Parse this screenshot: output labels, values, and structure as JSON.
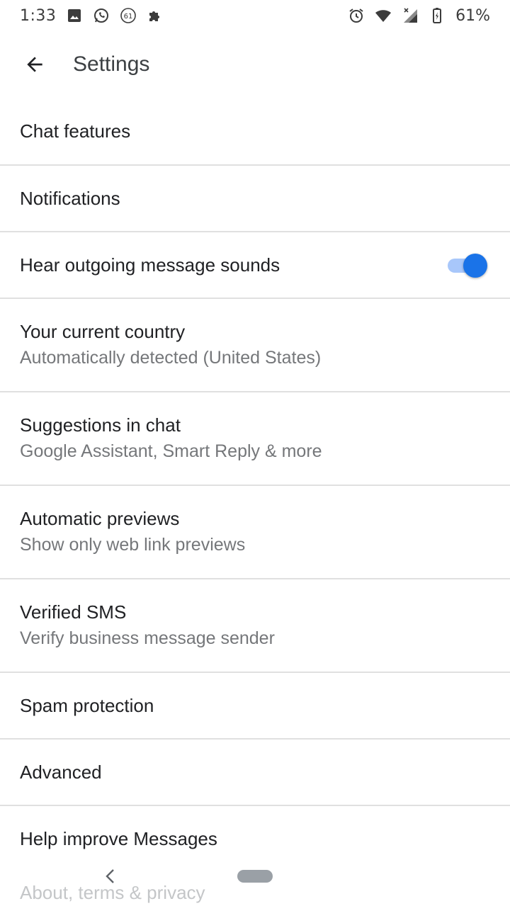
{
  "status_bar": {
    "time": "1:33",
    "notification_icons": [
      "image-icon",
      "whatsapp-icon",
      "badge-61-icon",
      "puzzle-icon"
    ],
    "badge_count": "61",
    "system_icons": [
      "alarm-icon",
      "wifi-icon",
      "signal-icon",
      "battery-icon"
    ],
    "battery_percent": "61%"
  },
  "app_bar": {
    "back_icon": "arrow-back-icon",
    "title": "Settings"
  },
  "settings": {
    "items": [
      {
        "title": "Chat features"
      },
      {
        "title": "Notifications"
      },
      {
        "title": "Hear outgoing message sounds",
        "toggle_on": true
      },
      {
        "title": "Your current country",
        "subtitle": "Automatically detected (United States)"
      },
      {
        "title": "Suggestions in chat",
        "subtitle": "Google Assistant, Smart Reply & more"
      },
      {
        "title": "Automatic previews",
        "subtitle": "Show only web link previews"
      },
      {
        "title": "Verified SMS",
        "subtitle": "Verify business message sender"
      },
      {
        "title": "Spam protection"
      },
      {
        "title": "Advanced"
      },
      {
        "title": "Help improve Messages"
      },
      {
        "title": "About, terms & privacy"
      }
    ]
  },
  "nav_bar": {
    "back_icon": "chevron-left-icon",
    "home_icon": "home-pill-icon"
  },
  "colors": {
    "accent": "#1a73e8",
    "accent_track": "#a8c7fa",
    "divider": "#e0e0e0",
    "secondary_text": "#75777a"
  }
}
